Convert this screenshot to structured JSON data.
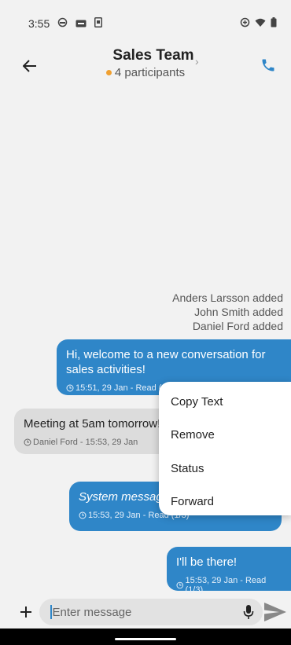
{
  "status_bar": {
    "time": "3:55"
  },
  "header": {
    "title": "Sales Team",
    "subtitle": "4 participants",
    "chevron": "›"
  },
  "system_messages": [
    "Anders Larsson added",
    "John Smith added",
    "Daniel Ford added"
  ],
  "messages": [
    {
      "text": "Hi, welcome to a new conversation for sales activities!",
      "meta": "15:51, 29 Jan - Read (1/3)"
    },
    {
      "text": "Meeting at 5am tomorrow!",
      "meta": "Daniel Ford - 15:53, 29 Jan"
    },
    {
      "text": "System message",
      "meta": "15:53, 29 Jan - Read (1/3)"
    },
    {
      "text": "I'll be there!",
      "meta": "15:53, 29 Jan - Read (1/3)"
    }
  ],
  "context_menu": [
    "Copy Text",
    "Remove",
    "Status",
    "Forward"
  ],
  "input": {
    "placeholder": "Enter message"
  },
  "colors": {
    "accent": "#2f86c8",
    "incoming": "#dcdcdc",
    "presence": "#f0a030"
  }
}
